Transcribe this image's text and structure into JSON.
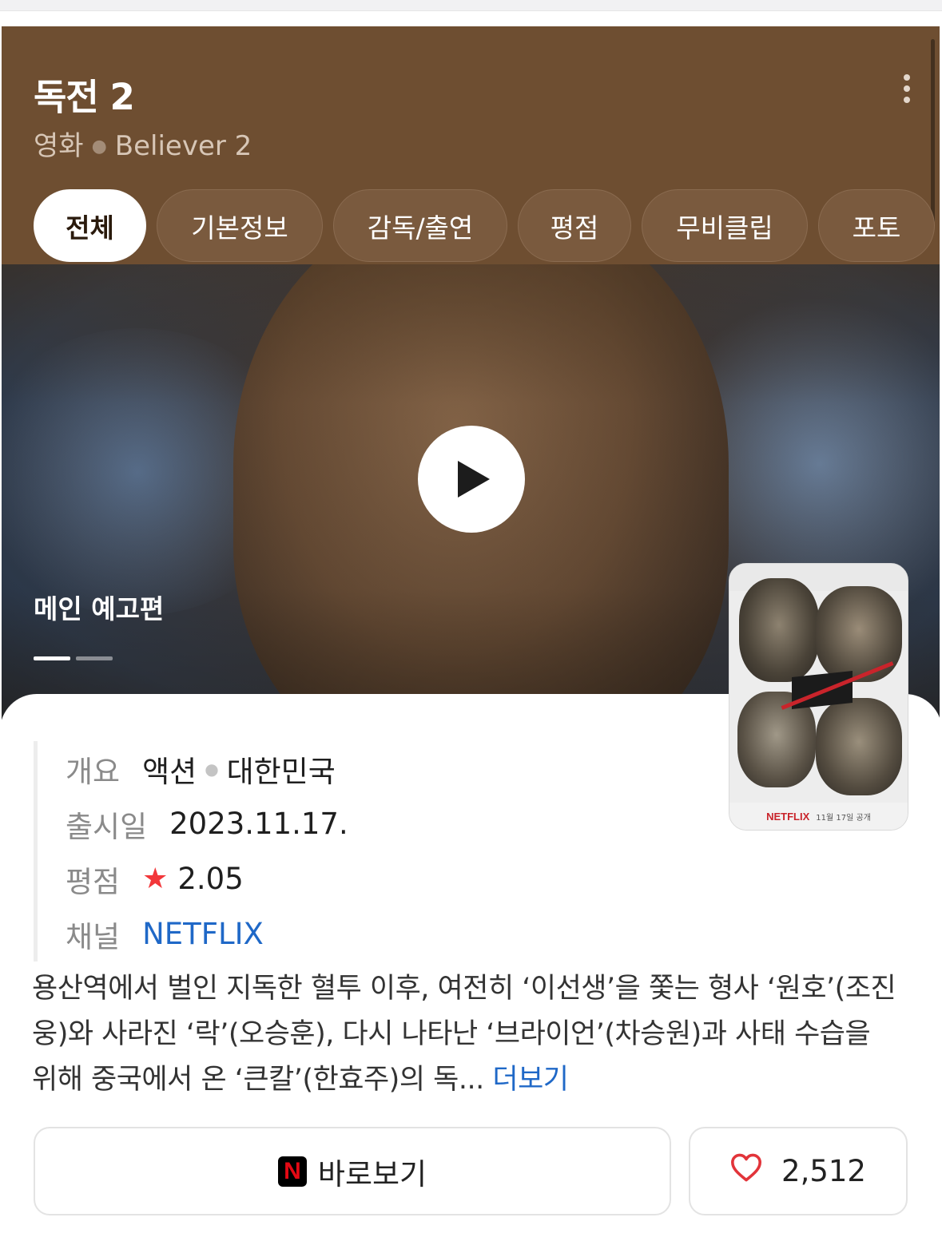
{
  "header": {
    "title": "독전 2",
    "category": "영화",
    "original_title": "Believer 2",
    "background_color": "#6e4e31"
  },
  "tabs": [
    {
      "label": "전체",
      "active": true
    },
    {
      "label": "기본정보",
      "active": false
    },
    {
      "label": "감독/출연",
      "active": false
    },
    {
      "label": "평점",
      "active": false
    },
    {
      "label": "무비클립",
      "active": false
    },
    {
      "label": "포토",
      "active": false
    }
  ],
  "video": {
    "label": "메인 예고편",
    "slide_count": 2,
    "active_slide": 1
  },
  "poster": {
    "logo_text": "NETFLIX",
    "release_note": "11월 17일 공개"
  },
  "info": {
    "overview_label": "개요",
    "genre": "액션",
    "country": "대한민국",
    "release_label": "출시일",
    "release_date": "2023.11.17.",
    "rating_label": "평점",
    "rating": "2.05",
    "channel_label": "채널",
    "channel": "NETFLIX"
  },
  "synopsis": {
    "text": "용산역에서 벌인 지독한 혈투 이후, 여전히 ‘이선생’을 쫓는 형사 ‘원호’(조진웅)와 사라진 ‘락’(오승훈), 다시 나타난 ‘브라이언’(차승원)과 사태 수습을 위해 중국에서 온 ‘큰칼’(한효주)의 독...",
    "more": "더보기"
  },
  "actions": {
    "watch_label": "바로보기",
    "watch_icon_letter": "N",
    "like_count": "2,512"
  },
  "colors": {
    "accent_link": "#1f68c7",
    "star": "#f2373a",
    "heart": "#e2343a"
  }
}
